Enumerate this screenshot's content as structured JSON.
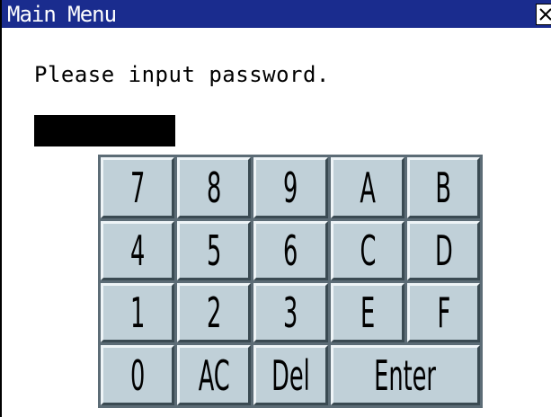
{
  "window": {
    "title": "Main Menu",
    "close_icon": "close-icon"
  },
  "prompt": "Please input password.",
  "password": {
    "value": ""
  },
  "keypad": {
    "rows": [
      [
        "7",
        "8",
        "9",
        "A",
        "B"
      ],
      [
        "4",
        "5",
        "6",
        "C",
        "D"
      ],
      [
        "1",
        "2",
        "3",
        "E",
        "F"
      ],
      [
        "0",
        "AC",
        "Del",
        "Enter"
      ]
    ]
  },
  "colors": {
    "titlebar": "#1a2c8e",
    "key_face": "#c0d0d8",
    "keypad_background": "#5c6c76",
    "password_field": "#000000"
  }
}
